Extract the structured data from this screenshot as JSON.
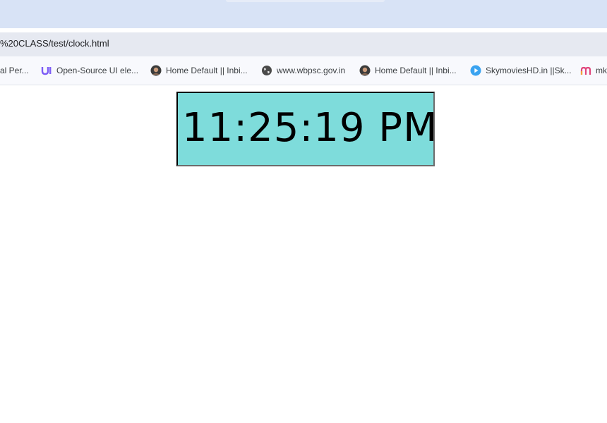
{
  "browser": {
    "address_bar": {
      "url": "%20CLASS/test/clock.html"
    },
    "bookmarks": [
      {
        "label": "al Per...",
        "icon": "none"
      },
      {
        "label": "Open-Source UI ele...",
        "icon": "ui-logo-icon"
      },
      {
        "label": "Home Default || Inbi...",
        "icon": "avatar-icon"
      },
      {
        "label": "www.wbpsc.gov.in",
        "icon": "globe-icon"
      },
      {
        "label": "Home Default || Inbi...",
        "icon": "avatar-icon"
      },
      {
        "label": "SkymoviesHD.in ||Sk...",
        "icon": "play-icon"
      },
      {
        "label": "mk",
        "icon": "m-logo-icon"
      }
    ]
  },
  "page": {
    "clock": {
      "time": "11:25:19 PM",
      "background": "#7edcdb"
    }
  },
  "colors": {
    "tabstrip": "#d8e3f6",
    "address_bar": "#e6e9f1",
    "bookmarks_bar": "#f8f9fd",
    "ui_logo": "#7c5cf5",
    "play_icon": "#3aa3f0",
    "m_logo": "#e0457b"
  }
}
